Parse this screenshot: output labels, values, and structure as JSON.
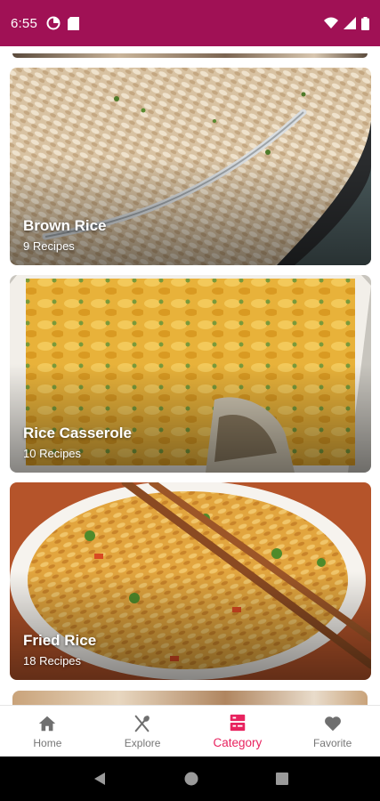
{
  "status_bar": {
    "time": "6:55",
    "background_color": "#a01155",
    "left_icons": [
      "data-saver-icon",
      "sd-card-icon"
    ],
    "right_icons": [
      "wifi-icon",
      "cell-signal-icon",
      "battery-icon"
    ]
  },
  "categories": [
    {
      "title": "Brown Rice",
      "count": "9 Recipes",
      "image": "brown-rice-image"
    },
    {
      "title": "Rice Casserole",
      "count": "10 Recipes",
      "image": "rice-casserole-image"
    },
    {
      "title": "Fried Rice",
      "count": "18 Recipes",
      "image": "fried-rice-image"
    }
  ],
  "bottom_nav": {
    "active_color": "#e8235f",
    "items": [
      {
        "label": "Home",
        "icon": "home-icon",
        "active": false
      },
      {
        "label": "Explore",
        "icon": "fork-spoon-icon",
        "active": false
      },
      {
        "label": "Category",
        "icon": "category-icon",
        "active": true
      },
      {
        "label": "Favorite",
        "icon": "heart-icon",
        "active": false
      }
    ]
  },
  "system_nav": [
    "back-icon",
    "home-circle-icon",
    "recents-icon"
  ]
}
